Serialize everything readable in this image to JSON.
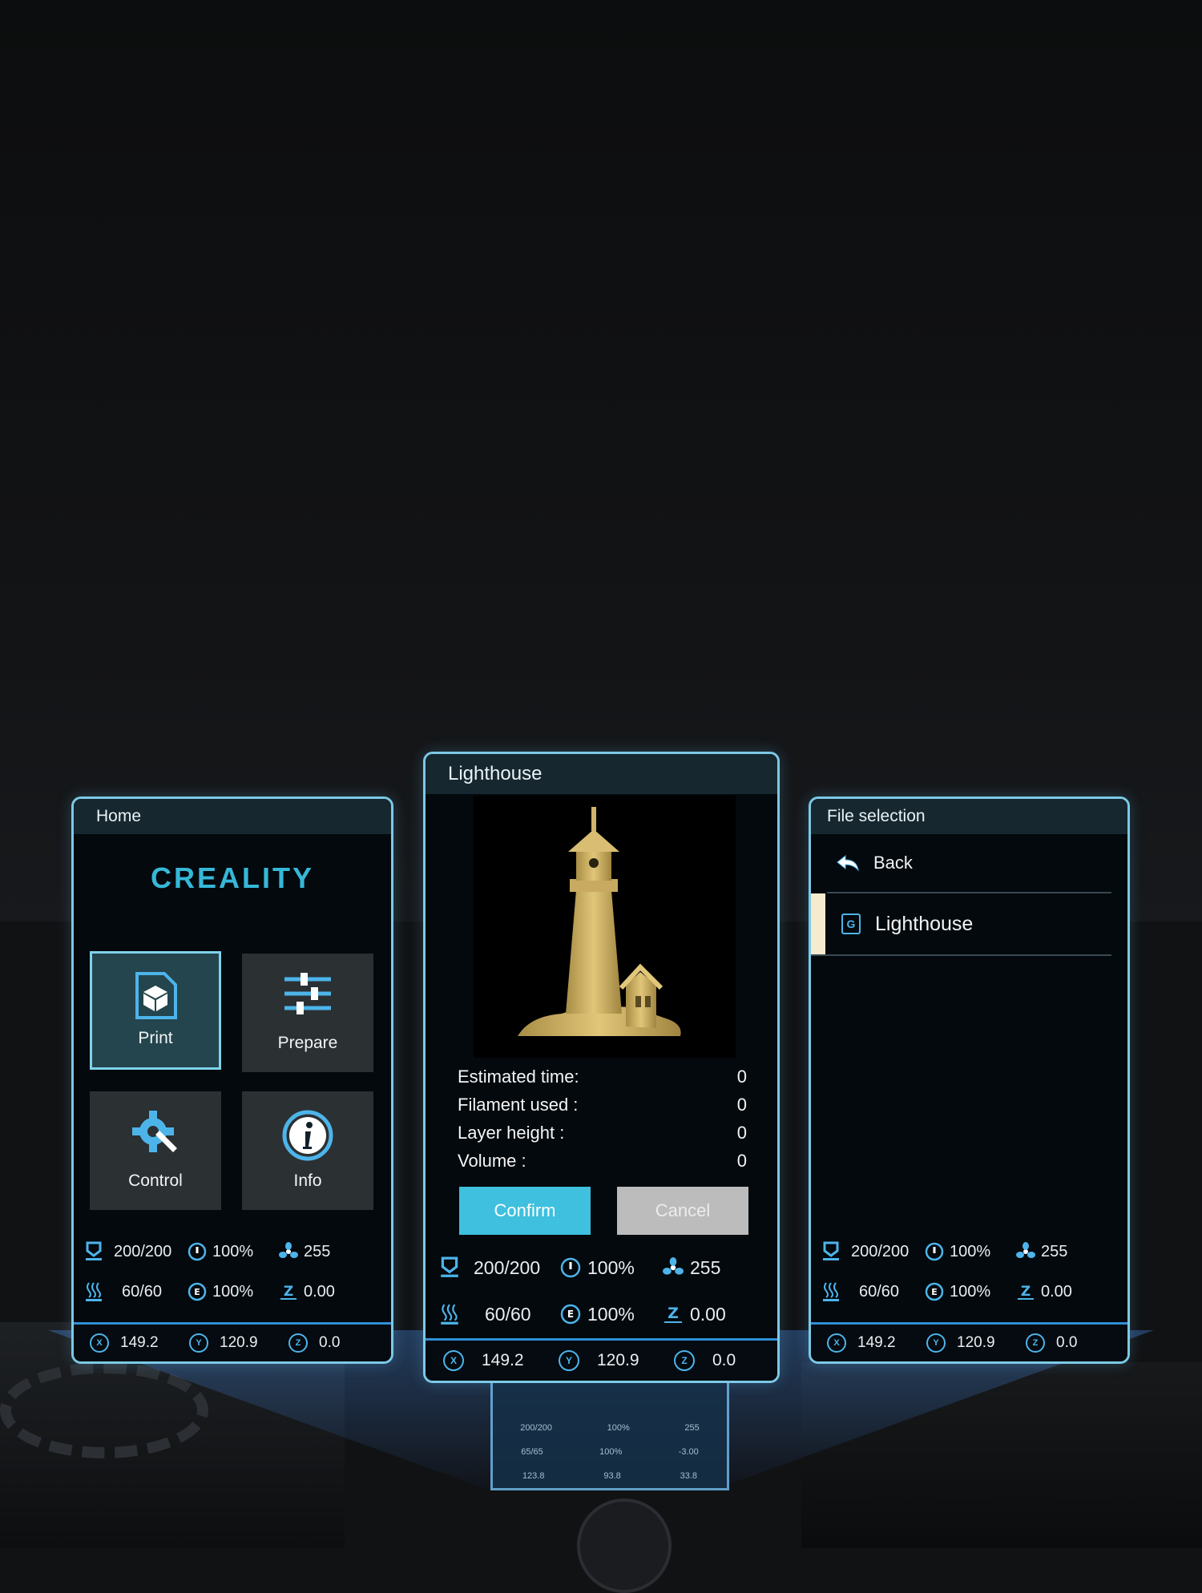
{
  "home_screen": {
    "title": "Home",
    "logo": "CREALITY",
    "tiles": [
      {
        "label": "Print",
        "icon": "print-icon",
        "selected": true
      },
      {
        "label": "Prepare",
        "icon": "sliders-icon",
        "selected": false
      },
      {
        "label": "Control",
        "icon": "gear-wrench-icon",
        "selected": false
      },
      {
        "label": "Info",
        "icon": "info-icon",
        "selected": false
      }
    ]
  },
  "status": {
    "nozzle_temp": "200/200",
    "speed": "100%",
    "fan": "255",
    "bed_temp": "60/60",
    "flow": "100%",
    "z_offset": "0.00"
  },
  "coords": {
    "x_label": "X",
    "x": "149.2",
    "y_label": "Y",
    "y": "120.9",
    "z_label": "Z",
    "z": "0.0"
  },
  "print_confirm": {
    "title": "Lighthouse",
    "info": [
      {
        "label": "Estimated time:",
        "value": "0"
      },
      {
        "label": "Filament used :",
        "value": "0"
      },
      {
        "label": "Layer height :",
        "value": "0"
      },
      {
        "label": "Volume :",
        "value": "0"
      }
    ],
    "confirm_label": "Confirm",
    "cancel_label": "Cancel"
  },
  "file_selection": {
    "title": "File selection",
    "back_label": "Back",
    "file_icon_letter": "G",
    "file_name": "Lighthouse"
  },
  "mini_screen": {
    "nozzle": "200/200",
    "speed": "100%",
    "fan": "255",
    "bed": "65/65",
    "flow": "100%",
    "z": "-3.00",
    "x": "123.8",
    "y": "93.8",
    "zpos": "33.8"
  },
  "colors": {
    "accent": "#3ec0de",
    "border": "#7cc9e6",
    "panel_bg": "#03090d",
    "model_gold": "#cdb064"
  }
}
